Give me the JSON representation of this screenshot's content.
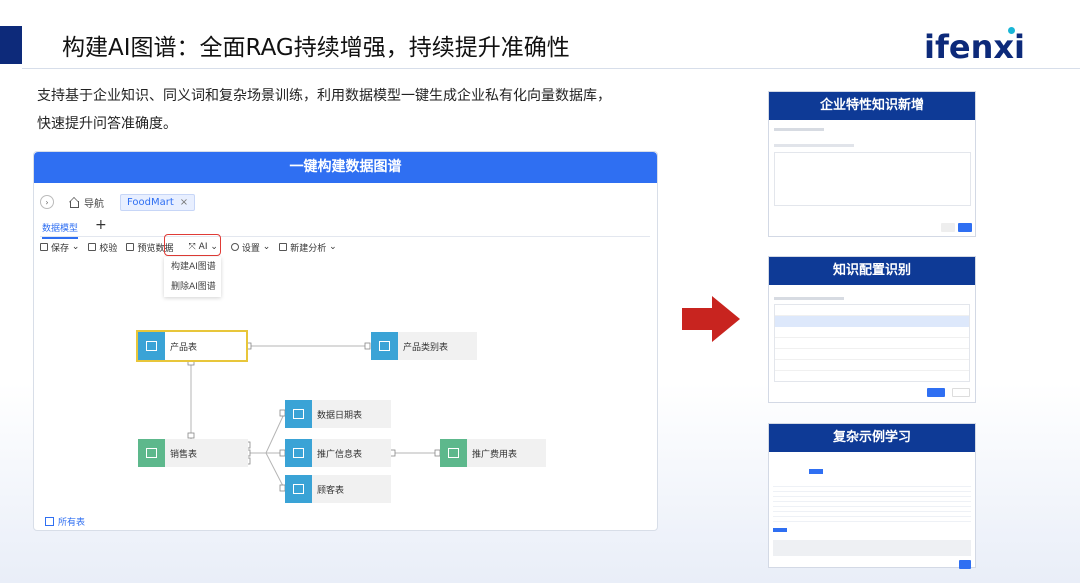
{
  "slide": {
    "title": "构建AI图谱：全面RAG持续增强，持续提升准确性",
    "logo": "ifenxi",
    "description_line1": "支持基于企业知识、同义词和复杂场景训练，利用数据模型一键生成企业私有化向量数据库，",
    "description_line2": "快速提升问答准确度。"
  },
  "app": {
    "header": "一键构建数据图谱",
    "nav_label": "导航",
    "tab_label": "FoodMart",
    "tab_close": "×",
    "subtab": "数据模型",
    "add_tab": "+",
    "toolbar": {
      "save": "保存",
      "validate": "校验",
      "preview": "预览数据",
      "ai": "AI",
      "settings": "设置",
      "new_analysis": "新建分析"
    },
    "ai_menu": [
      "构建AI图谱",
      "删除AI图谱"
    ],
    "nodes": {
      "product": "产品表",
      "category": "产品类别表",
      "sales": "销售表",
      "date": "数据日期表",
      "promo": "推广信息表",
      "promo_cost": "推广费用表",
      "customer": "顾客表"
    },
    "all_tables": "所有表"
  },
  "panels": [
    {
      "title": "企业特性知识新增"
    },
    {
      "title": "知识配置识别"
    },
    {
      "title": "复杂示例学习"
    }
  ],
  "colors": {
    "accent": "#2f6ff2",
    "panel_title_bg": "#0e3a96",
    "node_blue": "#3aa3d6",
    "node_green": "#5db88c",
    "highlight": "#e8c63a",
    "arrow_red": "#c8241f"
  }
}
